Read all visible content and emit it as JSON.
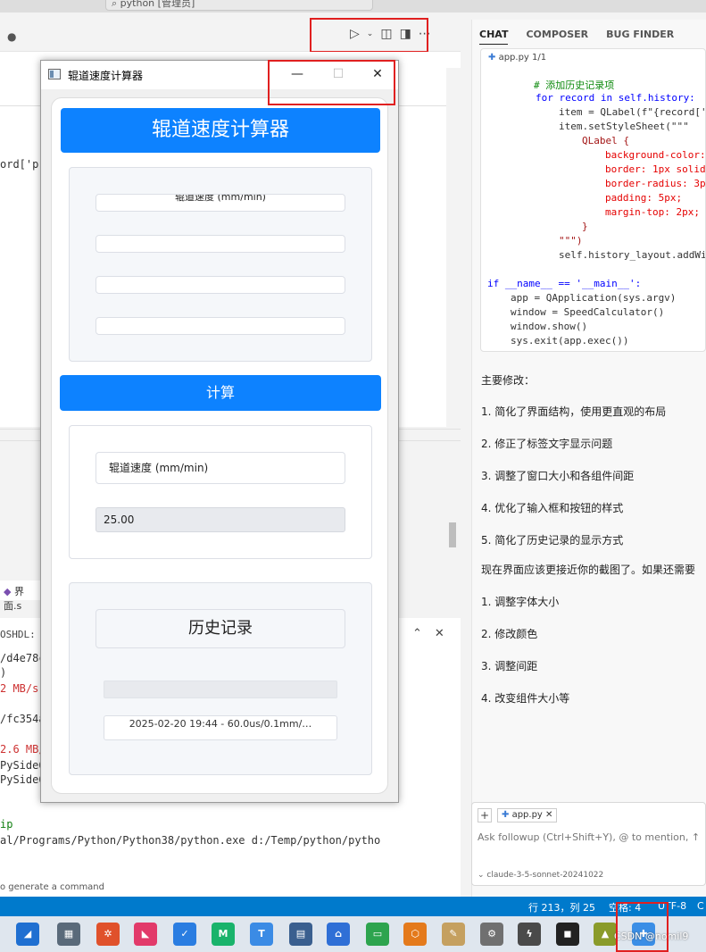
{
  "vscode": {
    "search_text": "python [管理员]",
    "editor_fragment": "ord['p",
    "file_tab_label": "界面.s",
    "terminal": {
      "header": "OSHDL: T",
      "lines": [
        "/d4e78c",
        ")",
        "2 MB/s",
        "",
        "/fc354a",
        "",
        "2.6 MB/",
        "PySide6",
        "PySide6",
        "",
        "ip",
        "al/Programs/Python/Python38/python.exe d:/Temp/python/pytho"
      ],
      "hint": "o generate a command"
    },
    "statusbar": {
      "position": "行 213，列 25",
      "spaces": "空格: 4",
      "encoding": "UTF-8",
      "eol": "C"
    }
  },
  "chat": {
    "tabs": [
      "CHAT",
      "COMPOSER",
      "BUG FINDER"
    ],
    "code_file": "app.py 1/1",
    "code_lines": [
      "# 添加历史记录项",
      "for record in self.history:",
      "item = QLabel(f\"{record['",
      "item.setStyleSheet(\"\"\"",
      "QLabel {",
      "background-color:",
      "border: 1px solid",
      "border-radius: 3p",
      "padding: 5px;",
      "margin-top: 2px;",
      "}",
      "\"\"\")",
      "self.history_layout.addWi",
      "",
      "if __name__ == '__main__':",
      "app = QApplication(sys.argv)",
      "window = SpeedCalculator()",
      "window.show()",
      "sys.exit(app.exec())"
    ],
    "messages": [
      "主要修改：",
      "1. 简化了界面结构，使用更直观的布局",
      "2. 修正了标签文字显示问题",
      "3. 调整了窗口大小和各组件间距",
      "4. 优化了输入框和按钮的样式",
      "5. 简化了历史记录的显示方式",
      "现在界面应该更接近你的截图了。如果还需要",
      "1. 调整字体大小",
      "2. 修改颜色",
      "3. 调整间距",
      "4. 改变组件大小等"
    ],
    "followup": {
      "plus": "+",
      "chip": "app.py",
      "placeholder": "Ask followup (Ctrl+Shift+Y), @ to mention, ↑",
      "model": "claude-3-5-sonnet-20241022"
    }
  },
  "calculator": {
    "window_title": "辊道速度计算器",
    "min_glyph": "—",
    "max_glyph": "☐",
    "close_glyph": "✕",
    "header": "辊道速度计算器",
    "inputs": [
      {
        "value": "辊道速度 (mm/min)",
        "clipped": true
      },
      {
        "value": ""
      },
      {
        "value": ""
      },
      {
        "value": ""
      }
    ],
    "calc_button": "计算",
    "result_label": "辊道速度 (mm/min)",
    "result_value": "25.00",
    "history_title": "历史记录",
    "history_entry": "2025-02-20 19:44 - 60.0us/0.1mm/…"
  },
  "taskbar": {
    "watermark": "CSDN @nomil9"
  }
}
